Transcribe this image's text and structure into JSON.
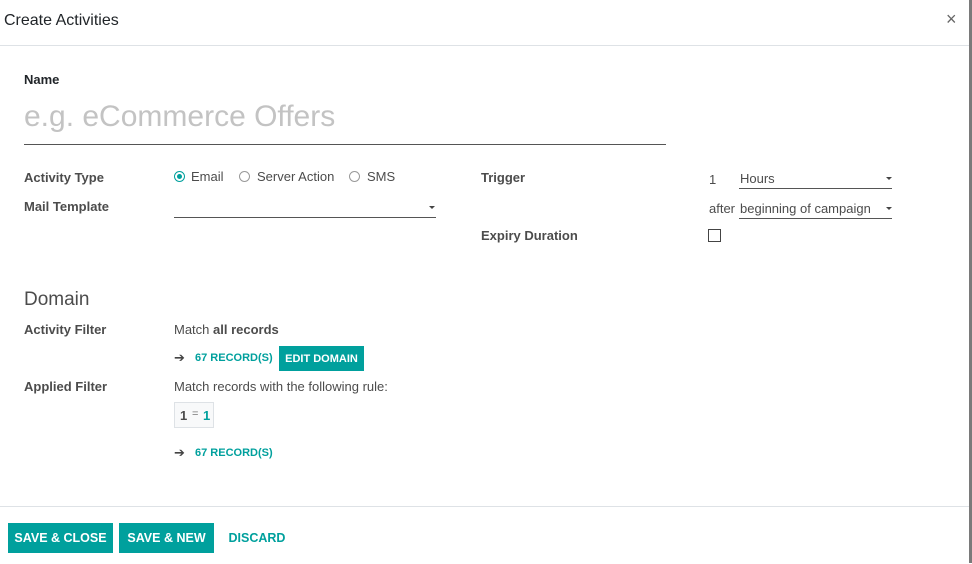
{
  "dialog": {
    "title": "Create Activities",
    "close": "×"
  },
  "name": {
    "label": "Name",
    "placeholder": "e.g. eCommerce Offers"
  },
  "activity_type": {
    "label": "Activity Type",
    "options": [
      "Email",
      "Server Action",
      "SMS"
    ],
    "selected": "Email"
  },
  "mail_template": {
    "label": "Mail Template",
    "value": ""
  },
  "trigger": {
    "label": "Trigger",
    "interval": "1",
    "unit": "Hours",
    "after_label": "after",
    "after_value": "beginning of campaign"
  },
  "expiry_duration": {
    "label": "Expiry Duration",
    "checked": false
  },
  "domain": {
    "title": "Domain",
    "activity_filter": {
      "label": "Activity Filter",
      "match_prefix": "Match ",
      "match_strong": "all records",
      "records": "67 RECORD(S)",
      "edit_button": "EDIT DOMAIN"
    },
    "applied_filter": {
      "label": "Applied Filter",
      "text": "Match records with the following rule:",
      "rule_left": "1",
      "rule_op": "=",
      "rule_right": "1",
      "records": "67 RECORD(S)"
    }
  },
  "footer": {
    "save_close": "SAVE & CLOSE",
    "save_new": "SAVE & NEW",
    "discard": "DISCARD"
  },
  "colors": {
    "accent": "#00a09d",
    "text": "#4c4c4c",
    "placeholder": "#c3c3c3"
  }
}
